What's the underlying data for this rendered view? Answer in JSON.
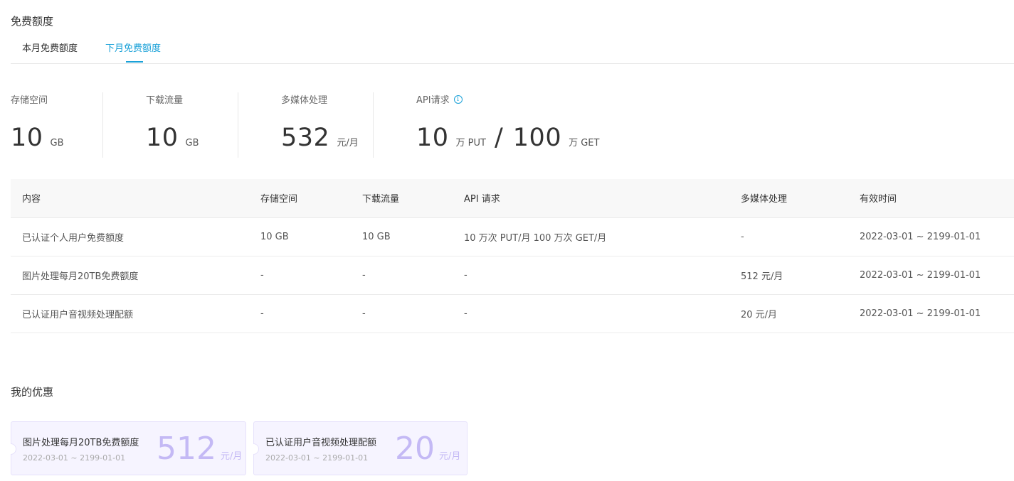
{
  "free_section": {
    "title": "免费额度",
    "tabs": [
      {
        "label": "本月免费额度",
        "active": false
      },
      {
        "label": "下月免费额度",
        "active": true
      }
    ],
    "accent_color": "#1aa1d8"
  },
  "stats": {
    "storage": {
      "label": "存储空间",
      "value": "10",
      "unit": "GB"
    },
    "download": {
      "label": "下载流量",
      "value": "10",
      "unit": "GB"
    },
    "media": {
      "label": "多媒体处理",
      "value": "532",
      "unit": "元/月"
    },
    "api": {
      "label": "API请求",
      "info_icon": "info-icon",
      "put_value": "10",
      "put_unit": "万 PUT",
      "separator": "/",
      "get_value": "100",
      "get_unit": "万 GET"
    }
  },
  "table": {
    "headers": [
      "内容",
      "存储空间",
      "下载流量",
      "API 请求",
      "多媒体处理",
      "有效时间"
    ],
    "rows": [
      [
        "已认证个人用户免费额度",
        "10 GB",
        "10 GB",
        "10 万次 PUT/月 100 万次 GET/月",
        "-",
        "2022-03-01 ~ 2199-01-01"
      ],
      [
        "图片处理每月20TB免费额度",
        "-",
        "-",
        "-",
        "512 元/月",
        "2022-03-01 ~ 2199-01-01"
      ],
      [
        "已认证用户音视频处理配额",
        "-",
        "-",
        "-",
        "20 元/月",
        "2022-03-01 ~ 2199-01-01"
      ]
    ]
  },
  "promo_section": {
    "title": "我的优惠",
    "coupons": [
      {
        "name": "图片处理每月20TB免费额度",
        "period": "2022-03-01 ~ 2199-01-01",
        "amount": "512",
        "unit": "元/月"
      },
      {
        "name": "已认证用户音视频处理配额",
        "period": "2022-03-01 ~ 2199-01-01",
        "amount": "20",
        "unit": "元/月"
      }
    ],
    "amount_color": "#c4b9f5"
  }
}
